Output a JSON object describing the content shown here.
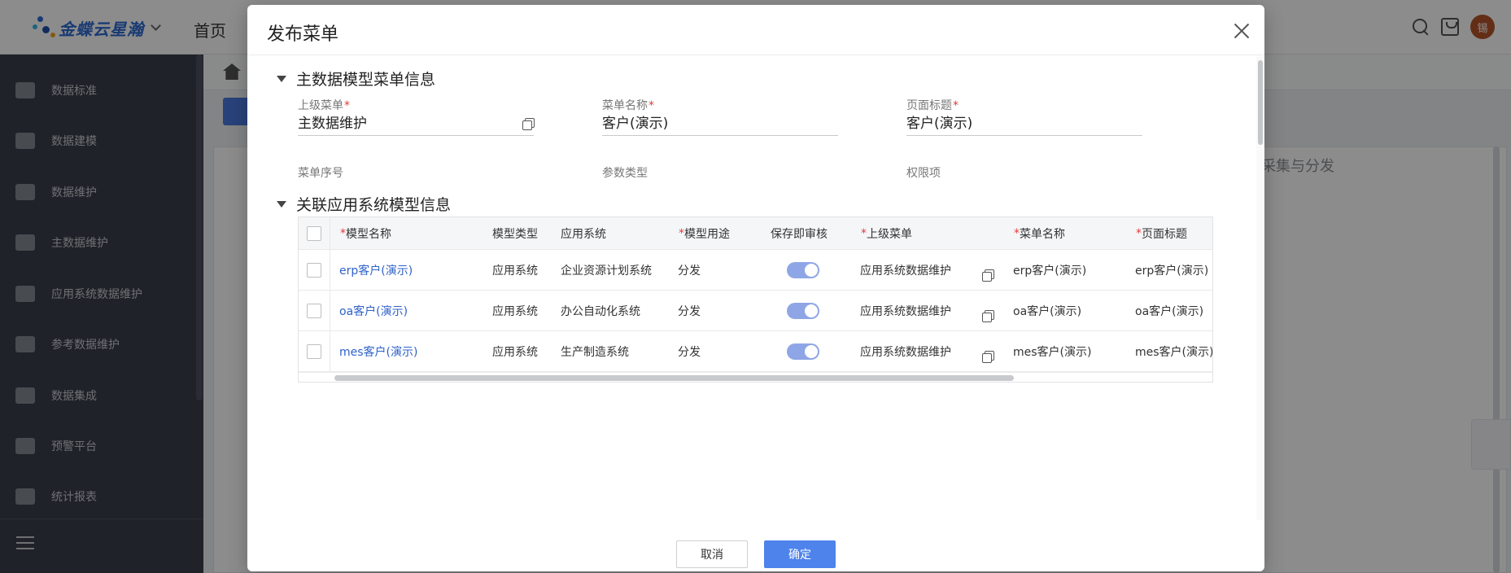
{
  "app": {
    "logo_text": "金蝶云星瀚",
    "home_tab": "首页",
    "avatar_text": "锡",
    "sidebar": [
      {
        "label": "数据标准",
        "icon": "chart-icon"
      },
      {
        "label": "数据建模",
        "icon": "puzzle-icon"
      },
      {
        "label": "数据维护",
        "icon": "monitor-icon"
      },
      {
        "label": "主数据维护",
        "icon": "cluster-icon"
      },
      {
        "label": "应用系统数据维护",
        "icon": "gears-icon"
      },
      {
        "label": "参考数据维护",
        "icon": "table-icon"
      },
      {
        "label": "数据集成",
        "icon": "cube-icon"
      },
      {
        "label": "预警平台",
        "icon": "alert-screen-icon"
      },
      {
        "label": "统计报表",
        "icon": "report-icon"
      }
    ],
    "bg_collect_text": "采集与分发"
  },
  "modal": {
    "title": "发布菜单",
    "section1_title": "主数据模型菜单信息",
    "section2_title": "关联应用系统模型信息",
    "fields": {
      "parent_menu": {
        "label": "上级菜单",
        "value": "主数据维护"
      },
      "menu_name": {
        "label": "菜单名称",
        "value": "客户(演示)"
      },
      "page_title": {
        "label": "页面标题",
        "value": "客户(演示)"
      },
      "menu_order": {
        "label": "菜单序号"
      },
      "param_type": {
        "label": "参数类型"
      },
      "permission": {
        "label": "权限项"
      }
    },
    "table": {
      "headers": {
        "model_name": "模型名称",
        "model_type": "模型类型",
        "app_system": "应用系统",
        "model_use": "模型用途",
        "save_audit": "保存即审核",
        "parent_menu": "上级菜单",
        "menu_name": "菜单名称",
        "page_title": "页面标题"
      },
      "rows": [
        {
          "model_name": "erp客户(演示)",
          "model_type": "应用系统",
          "app_system": "企业资源计划系统",
          "model_use": "分发",
          "save_audit": true,
          "parent_menu": "应用系统数据维护",
          "menu_name": "erp客户(演示)",
          "page_title": "erp客户(演示)"
        },
        {
          "model_name": "oa客户(演示)",
          "model_type": "应用系统",
          "app_system": "办公自动化系统",
          "model_use": "分发",
          "save_audit": true,
          "parent_menu": "应用系统数据维护",
          "menu_name": "oa客户(演示)",
          "page_title": "oa客户(演示)"
        },
        {
          "model_name": "mes客户(演示)",
          "model_type": "应用系统",
          "app_system": "生产制造系统",
          "model_use": "分发",
          "save_audit": true,
          "parent_menu": "应用系统数据维护",
          "menu_name": "mes客户(演示)",
          "page_title": "mes客户(演示)"
        }
      ]
    },
    "buttons": {
      "cancel": "取消",
      "confirm": "确定"
    }
  }
}
